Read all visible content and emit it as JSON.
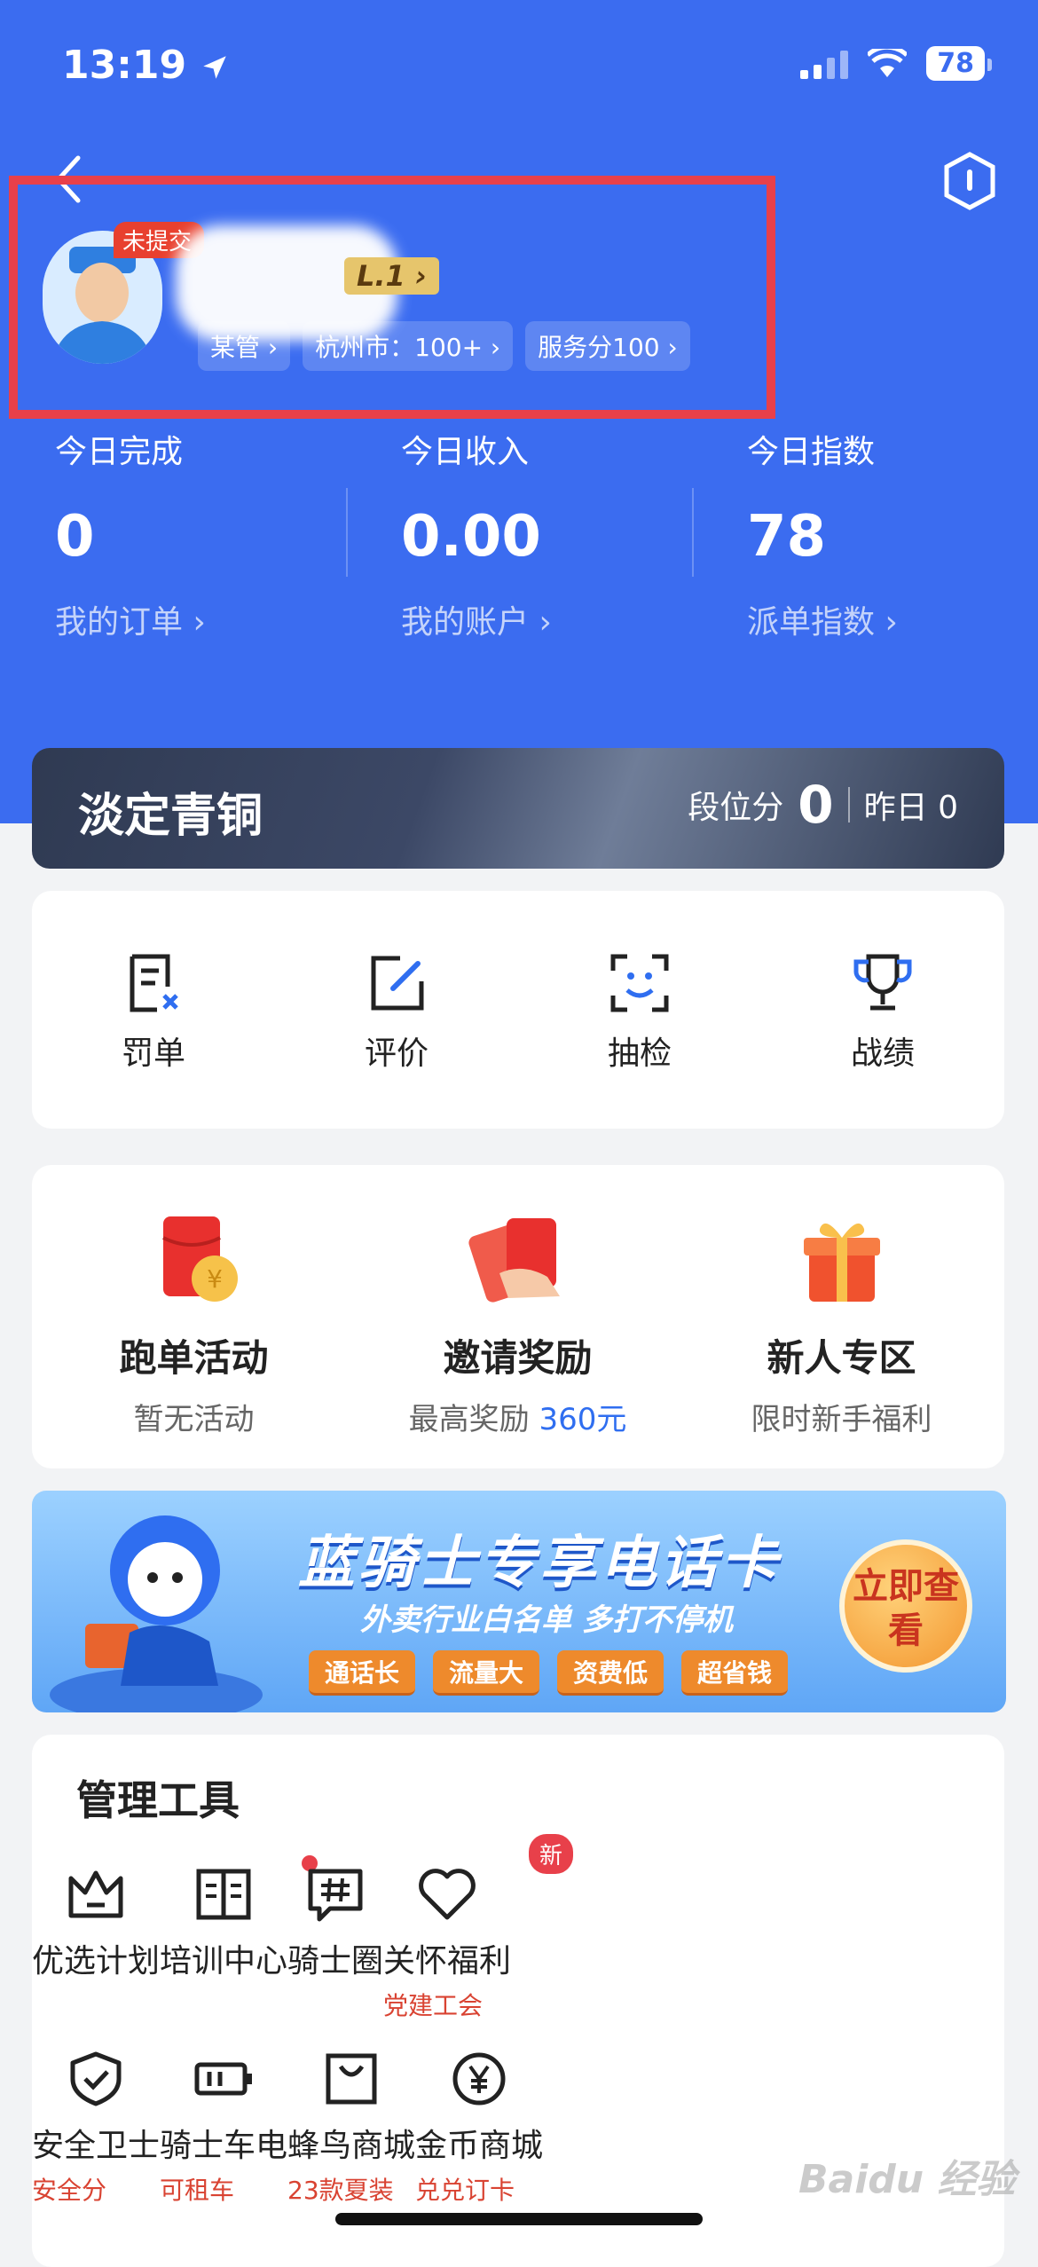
{
  "status_bar": {
    "time": "13:19",
    "battery": "78"
  },
  "profile": {
    "avatar_badge": "未提交",
    "level": "L.1",
    "tags": [
      "某管",
      "杭州市：100+",
      "服务分100"
    ]
  },
  "stats": [
    {
      "label": "今日完成",
      "value": "0",
      "link": "我的订单 ›"
    },
    {
      "label": "今日收入",
      "value": "0.00",
      "link": "我的账户 ›"
    },
    {
      "label": "今日指数",
      "value": "78",
      "link": "派单指数 ›"
    }
  ],
  "rank": {
    "title": "淡定青铜",
    "score_label": "段位分",
    "score": "0",
    "yesterday": "昨日 0"
  },
  "quick_actions": [
    {
      "label": "罚单",
      "icon": "penalty-icon"
    },
    {
      "label": "评价",
      "icon": "edit-icon"
    },
    {
      "label": "抽检",
      "icon": "scan-face-icon"
    },
    {
      "label": "战绩",
      "icon": "trophy-icon"
    }
  ],
  "activities": [
    {
      "title": "跑单活动",
      "desc": "暂无活动"
    },
    {
      "title": "邀请奖励",
      "desc_prefix": "最高奖励 ",
      "desc_highlight": "360元"
    },
    {
      "title": "新人专区",
      "desc": "限时新手福利"
    }
  ],
  "banner": {
    "title": "蓝骑士专享电话卡",
    "subtitle": "外卖行业白名单 多打不停机",
    "tags": [
      "通话长",
      "流量大",
      "资费低",
      "超省钱"
    ],
    "button": "立即查看"
  },
  "tools": {
    "title": "管理工具",
    "row1": [
      {
        "label": "优选计划",
        "icon": "crown-icon"
      },
      {
        "label": "培训中心",
        "icon": "book-icon"
      },
      {
        "label": "骑士圈",
        "icon": "chat-hash-icon"
      },
      {
        "label": "关怀福利",
        "sub": "党建工会",
        "icon": "heart-icon",
        "badge": "新"
      }
    ],
    "row2": [
      {
        "label": "安全卫士",
        "sub": "安全分",
        "icon": "shield-check-icon"
      },
      {
        "label": "骑士车电",
        "sub": "可租车",
        "icon": "battery-icon"
      },
      {
        "label": "蜂鸟商城",
        "sub": "23款夏装",
        "icon": "shopping-bag-icon"
      },
      {
        "label": "金币商城",
        "sub": "兑兑订卡",
        "icon": "yen-coin-icon"
      }
    ]
  },
  "watermark": "Baidu 经验"
}
